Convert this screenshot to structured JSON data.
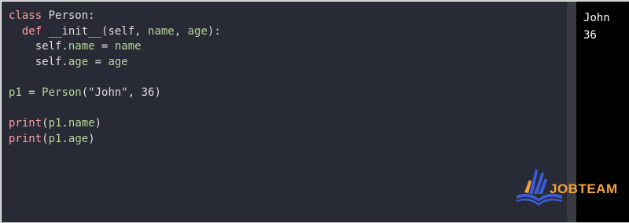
{
  "code": {
    "lines": [
      [
        {
          "t": "class",
          "c": "kw"
        },
        {
          "t": " Person:",
          "c": "pl"
        }
      ],
      [
        {
          "t": "  def",
          "c": "kw"
        },
        {
          "t": " __init__(self, ",
          "c": "pl"
        },
        {
          "t": "name",
          "c": "attr"
        },
        {
          "t": ", ",
          "c": "pl"
        },
        {
          "t": "age",
          "c": "attr"
        },
        {
          "t": "):",
          "c": "pl"
        }
      ],
      [
        {
          "t": "    self.",
          "c": "pl"
        },
        {
          "t": "name",
          "c": "attr"
        },
        {
          "t": " = ",
          "c": "pl"
        },
        {
          "t": "name",
          "c": "attr"
        }
      ],
      [
        {
          "t": "    self.",
          "c": "pl"
        },
        {
          "t": "age",
          "c": "attr"
        },
        {
          "t": " = ",
          "c": "pl"
        },
        {
          "t": "age",
          "c": "attr"
        }
      ],
      [],
      [
        {
          "t": "p1",
          "c": "attr"
        },
        {
          "t": " = ",
          "c": "pl"
        },
        {
          "t": "Person",
          "c": "attr"
        },
        {
          "t": "(\"John\", 36)",
          "c": "pl"
        }
      ],
      [],
      [
        {
          "t": "print",
          "c": "fn"
        },
        {
          "t": "(",
          "c": "pl"
        },
        {
          "t": "p1",
          "c": "attr"
        },
        {
          "t": ".",
          "c": "pl"
        },
        {
          "t": "name",
          "c": "attr"
        },
        {
          "t": ")",
          "c": "pl"
        }
      ],
      [
        {
          "t": "print",
          "c": "fn"
        },
        {
          "t": "(",
          "c": "pl"
        },
        {
          "t": "p1",
          "c": "attr"
        },
        {
          "t": ".",
          "c": "pl"
        },
        {
          "t": "age",
          "c": "attr"
        },
        {
          "t": ")",
          "c": "pl"
        }
      ]
    ]
  },
  "output": {
    "lines": [
      "John",
      "36"
    ]
  },
  "logo": {
    "text": "JOBTEAM",
    "icon": "book-hand-icon",
    "colors": {
      "blue": "#3b5bdb",
      "orange": "#f5a23a"
    }
  },
  "theme": {
    "editor_bg": "#282a35",
    "keyword": "#ff9e9e",
    "identifier": "#b6d69a",
    "text": "#dddddd",
    "output_bg": "#000000",
    "output_text": "#ffffff"
  }
}
